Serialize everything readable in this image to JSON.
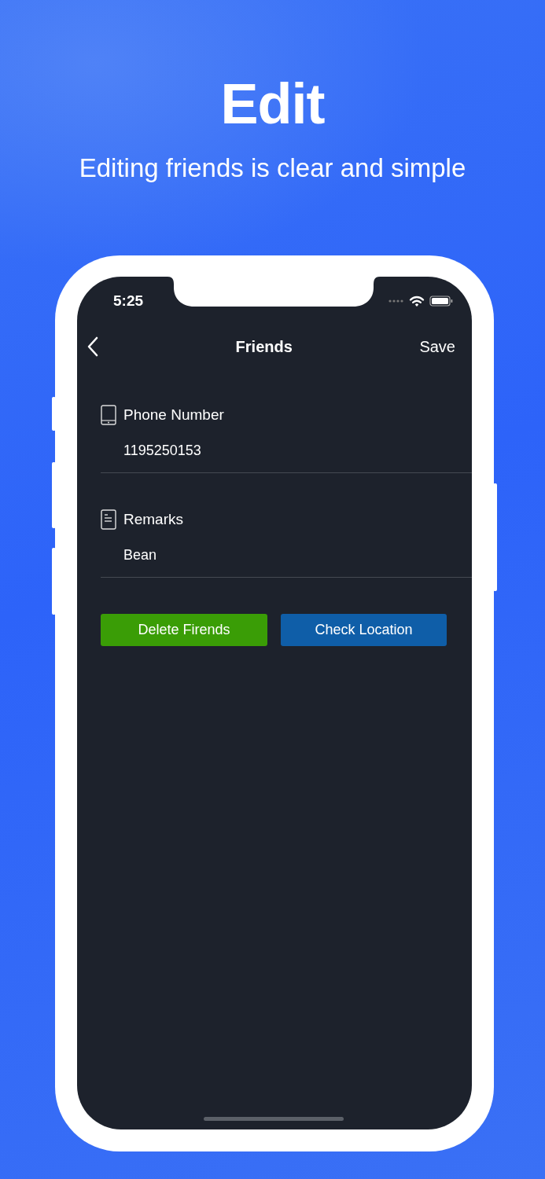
{
  "header": {
    "title": "Edit",
    "subtitle": "Editing friends is clear and simple"
  },
  "status_bar": {
    "time": "5:25"
  },
  "nav": {
    "title": "Friends",
    "action": "Save"
  },
  "fields": [
    {
      "kind": "phone",
      "label": "Phone Number",
      "value": "1195250153"
    },
    {
      "kind": "remarks",
      "label": "Remarks",
      "value": "Bean"
    }
  ],
  "buttons": [
    {
      "kind": "delete",
      "label": "Delete Firends"
    },
    {
      "kind": "location",
      "label": "Check Location"
    }
  ]
}
